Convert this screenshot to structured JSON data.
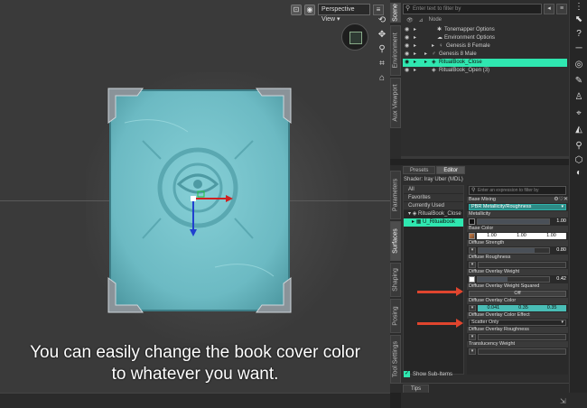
{
  "viewport": {
    "view_name": "Perspective View",
    "caption_line1": "You can easily change the book cover color",
    "caption_line2": "to whatever you want."
  },
  "left_side_tabs": [
    "Scene",
    "Environment",
    "Aux Viewport"
  ],
  "scene": {
    "search_placeholder": "Enter text to filter by",
    "column_header": "Node",
    "items": [
      {
        "label": "Tonemapper Options",
        "selected": false
      },
      {
        "label": "Environment Options",
        "selected": false
      },
      {
        "label": "Genesis 8 Female",
        "selected": false
      },
      {
        "label": "Genesis 8 Male",
        "selected": false
      },
      {
        "label": "RitualBook_Close",
        "selected": true
      },
      {
        "label": "RitualBook_Open (3)",
        "selected": false
      }
    ]
  },
  "surface_side_tabs": [
    "Parameters",
    "Surfaces",
    "Shaping",
    "Posing",
    "Tool Settings"
  ],
  "surfaces": {
    "tab_presets": "Presets",
    "tab_editor": "Editor",
    "shader_line": "Shader:  Iray Uber (MDL)",
    "tree": {
      "all": "All",
      "favorites": "Favorites",
      "currently_used": "Currently Used",
      "object": "RitualBook_Close",
      "selected_surface": "U_Ritualbook"
    },
    "show_sub_items": "Show Sub-Items",
    "prop_search_placeholder": "Enter an expression to filter by",
    "properties": {
      "base_mixing_label": "Base Mixing",
      "base_mixing_value": "PBR Metallicity/Roughness",
      "metallicity_label": "Metallicity",
      "metallicity_value": "1.00",
      "base_color_label": "Base Color",
      "base_color_r": "1.00",
      "base_color_g": "1.00",
      "base_color_b": "1.00",
      "diffuse_strength_label": "Diffuse Strength",
      "diffuse_strength_value": "0.80",
      "diffuse_roughness_label": "Diffuse Roughness",
      "diffuse_overlay_weight_label": "Diffuse Overlay Weight",
      "diffuse_overlay_weight_value": "0.42",
      "overlay_weight_squared_label": "Diffuse Overlay Weight Squared",
      "overlay_weight_squared_value": "Off",
      "overlay_color_label": "Diffuse Overlay Color",
      "overlay_color_r": "0.041",
      "overlay_color_g": "0.35",
      "overlay_color_b": "0.35",
      "overlay_color_effect_label": "Diffuse Overlay Color Effect",
      "overlay_color_effect_value": "Scatter Only",
      "overlay_roughness_label": "Diffuse Overlay Roughness",
      "translucency_weight_label": "Translucency Weight"
    },
    "tips_tab": "Tips"
  },
  "colors": {
    "accent": "#2fe7b0",
    "arrow": "#e0452e",
    "overlay_color": "#49bdb6",
    "book_cover": "#7fc8cf"
  }
}
